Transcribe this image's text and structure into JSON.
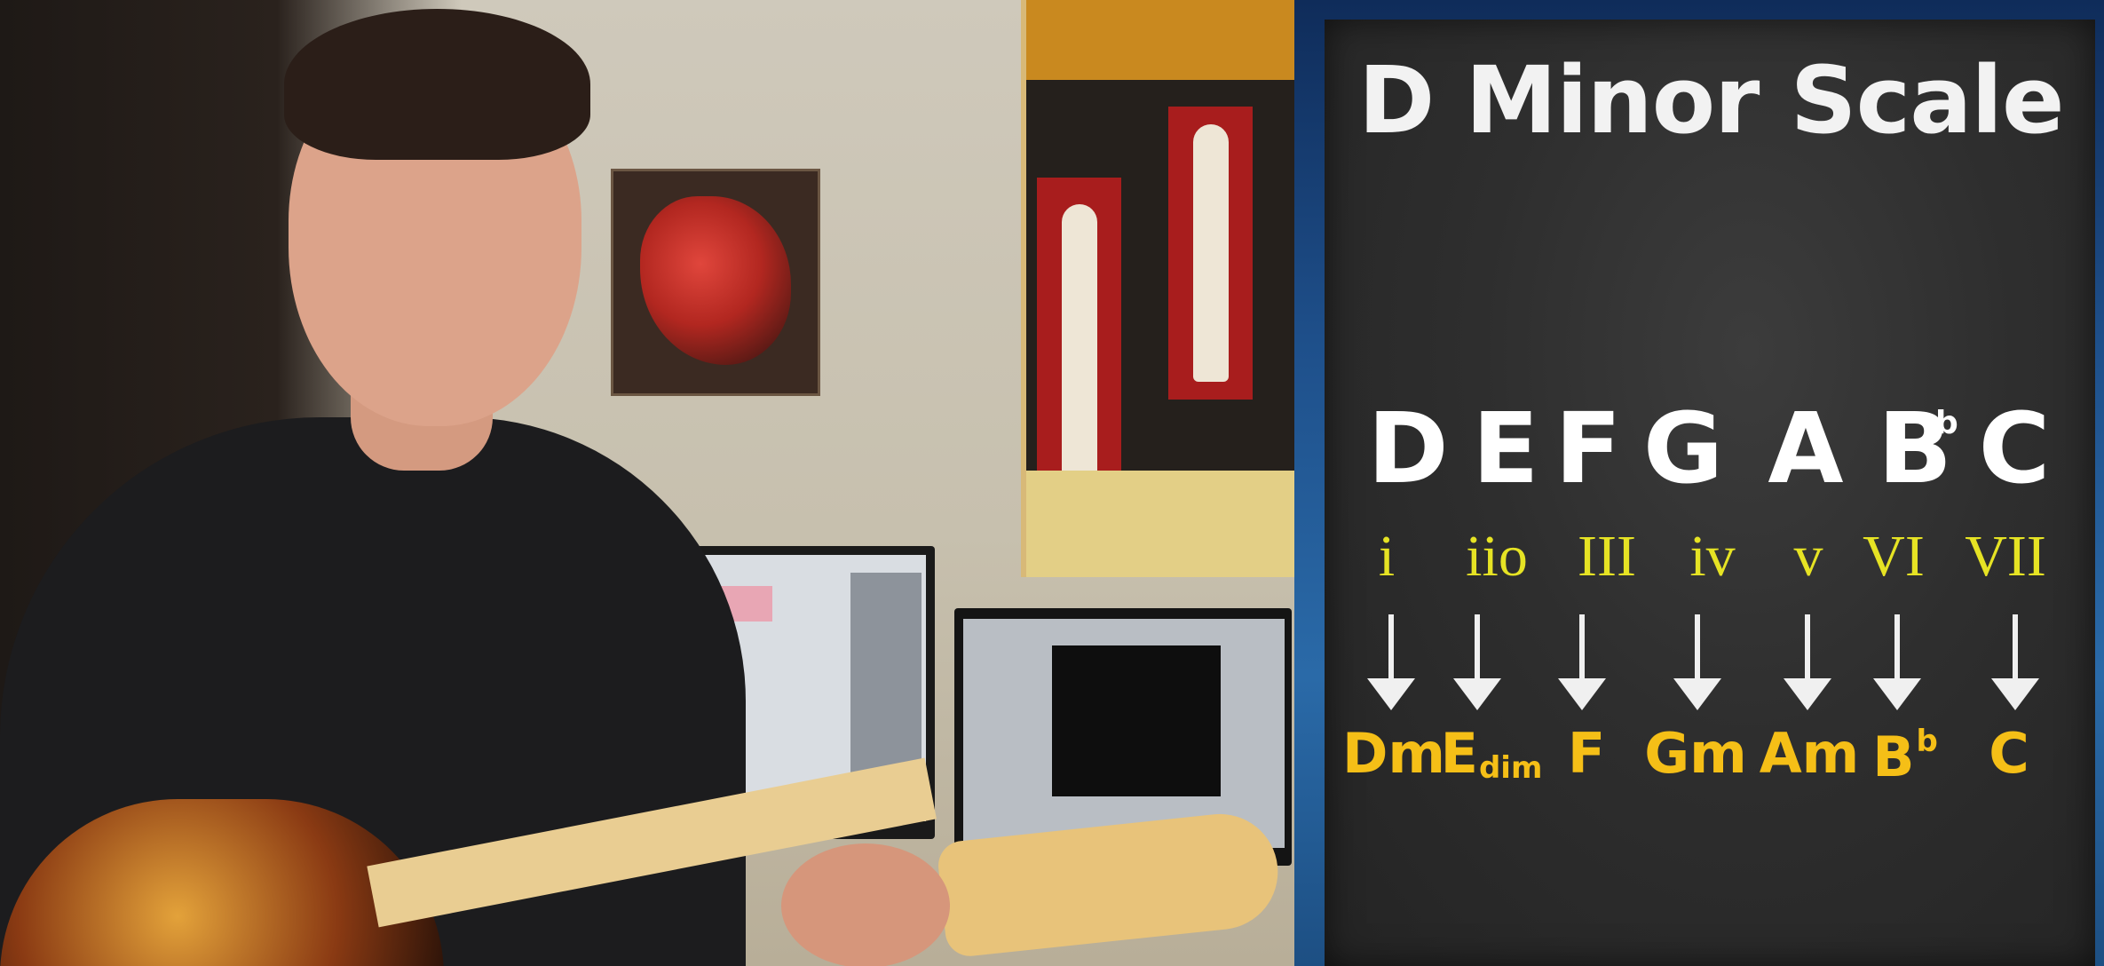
{
  "slide": {
    "title": "D Minor Scale",
    "notes": [
      {
        "name": "D"
      },
      {
        "name": "E"
      },
      {
        "name": "F"
      },
      {
        "name": "G"
      },
      {
        "name": "A"
      },
      {
        "name": "B",
        "flat": "b"
      },
      {
        "name": "C"
      }
    ],
    "degrees": [
      "i",
      "iio",
      "III",
      "iv",
      "v",
      "VI",
      "VII"
    ],
    "chords": [
      {
        "root": "Dm"
      },
      {
        "root": "E",
        "sub": "dim"
      },
      {
        "root": "F"
      },
      {
        "root": "Gm"
      },
      {
        "root": "Am"
      },
      {
        "root": "B",
        "sup": "b"
      },
      {
        "root": "C"
      }
    ]
  },
  "colors": {
    "title": "#f2f2f2",
    "notes": "#ffffff",
    "degrees": "#e6e324",
    "chords": "#f5bf17",
    "frame": "#1e4f8a"
  },
  "video": {
    "subject": "guitar-instructor-icon"
  }
}
